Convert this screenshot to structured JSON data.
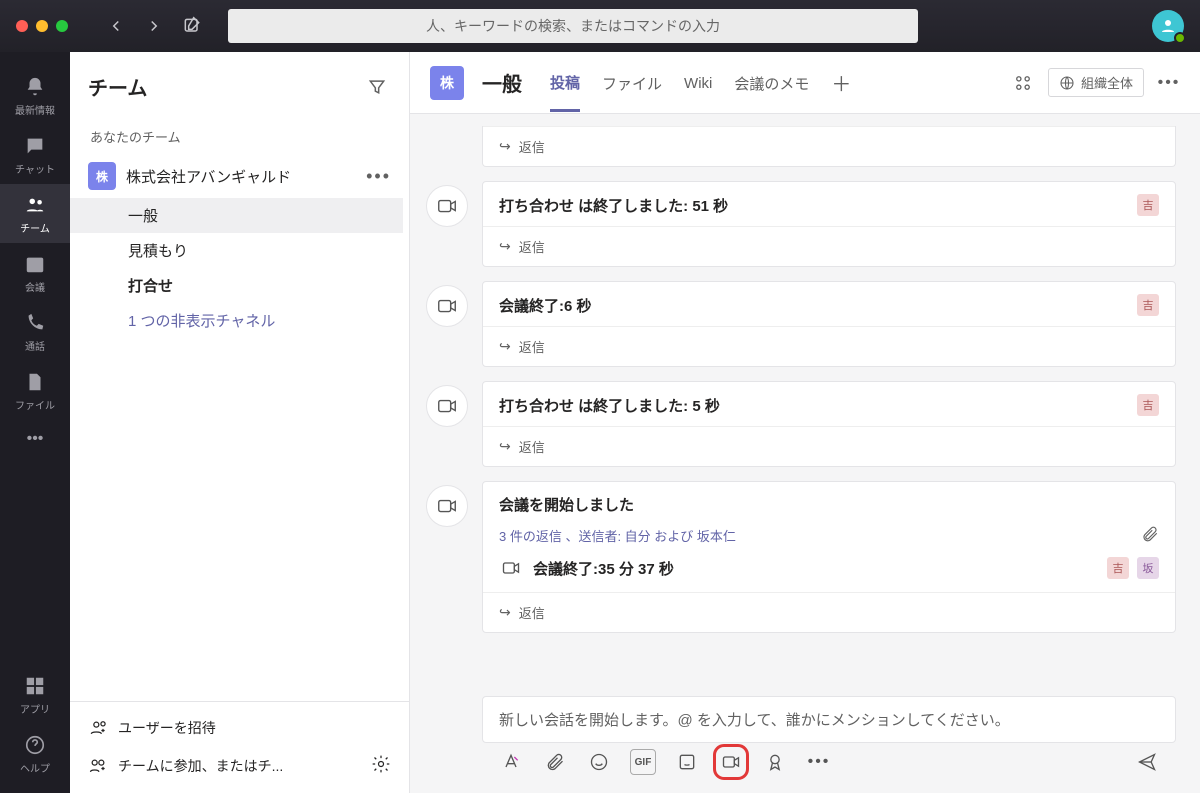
{
  "search": {
    "placeholder": "人、キーワードの検索、またはコマンドの入力"
  },
  "rail": {
    "items": [
      {
        "id": "activity",
        "label": "最新情報"
      },
      {
        "id": "chat",
        "label": "チャット"
      },
      {
        "id": "teams",
        "label": "チーム"
      },
      {
        "id": "meetings",
        "label": "会議"
      },
      {
        "id": "calls",
        "label": "通話"
      },
      {
        "id": "files",
        "label": "ファイル"
      }
    ],
    "apps": "アプリ",
    "help": "ヘルプ"
  },
  "panel": {
    "title": "チーム",
    "section": "あなたのチーム",
    "team": {
      "initial": "株",
      "name": "株式会社アバンギャルド"
    },
    "channels": {
      "general": "一般",
      "estimate": "見積もり",
      "meeting": "打合せ",
      "hidden": "1 つの非表示チャネル"
    },
    "footer": {
      "invite": "ユーザーを招待",
      "joincreate": "チームに参加、またはチ..."
    }
  },
  "header": {
    "team_initial": "株",
    "channel": "一般",
    "tabs": {
      "posts": "投稿",
      "files": "ファイル",
      "wiki": "Wiki",
      "notes": "会議のメモ"
    },
    "org": "組織全体"
  },
  "messages": {
    "reply": "返信",
    "m1": {
      "title": "打ち合わせ は終了しました: 51 秒",
      "avatar": "吉"
    },
    "m2": {
      "title": "会議終了:6 秒",
      "avatar": "吉"
    },
    "m3": {
      "title": "打ち合わせ は終了しました: 5 秒",
      "avatar": "吉"
    },
    "m4": {
      "title": "会議を開始しました",
      "thread": "3 件の返信 、送信者: 自分 および 坂本仁",
      "sub": "会議終了:35 分 37 秒",
      "av1": "吉",
      "av2": "坂"
    }
  },
  "compose": {
    "placeholder": "新しい会話を開始します。@ を入力して、誰かにメンションしてください。"
  }
}
